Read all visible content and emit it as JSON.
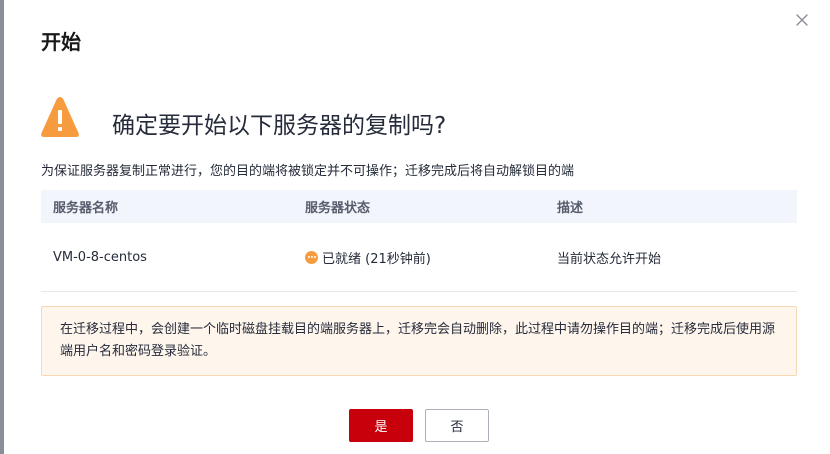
{
  "dialog": {
    "title": "开始",
    "question": "确定要开始以下服务器的复制吗?",
    "subtitle": "为保证服务器复制正常进行，您的目的端将被锁定并不可操作；迁移完成后将自动解锁目的端"
  },
  "table": {
    "headers": [
      "服务器名称",
      "服务器状态",
      "描述"
    ],
    "rows": [
      {
        "name": "VM-0-8-centos",
        "status": "已就绪 (21秒钟前)",
        "description": "当前状态允许开始"
      }
    ]
  },
  "notice": {
    "text": "在迁移过程中，会创建一个临时磁盘挂载目的端服务器上，迁移完会自动删除，此过程中请勿操作目的端；迁移完成后使用源端用户名和密码登录验证。"
  },
  "buttons": {
    "yes": "是",
    "no": "否"
  },
  "colors": {
    "primary": "#c7000b",
    "warning": "#f79b3f",
    "notice_bg": "#fef5ec",
    "header_bg": "#f2f5fc"
  },
  "icons": {
    "close": "close-icon",
    "warning": "warning-icon",
    "status": "status-pending-icon"
  }
}
